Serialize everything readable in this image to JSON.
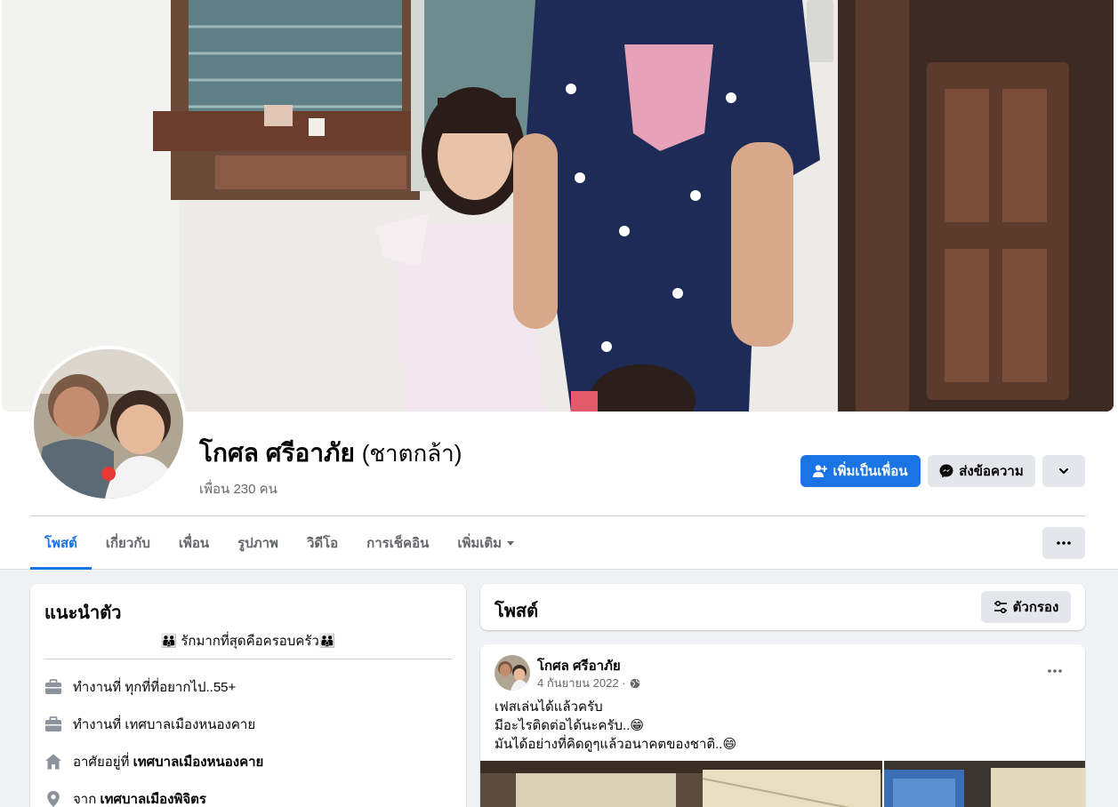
{
  "profile": {
    "name": "โกศล ศรีอาภัย",
    "alternate_name": "(ชาตกล้า)",
    "friends_count": "เพื่อน 230 คน"
  },
  "actions": {
    "add_friend": "เพิ่มเป็นเพื่อน",
    "message": "ส่งข้อความ"
  },
  "tabs": [
    {
      "label": "โพสต์",
      "active": true
    },
    {
      "label": "เกี่ยวกับ"
    },
    {
      "label": "เพื่อน"
    },
    {
      "label": "รูปภาพ"
    },
    {
      "label": "วิดีโอ"
    },
    {
      "label": "การเช็คอิน"
    },
    {
      "label": "เพิ่มเติม"
    }
  ],
  "intro": {
    "title": "แนะนำตัว",
    "bio": "👪 รักมากที่สุดคือครอบครัว👪",
    "items": [
      {
        "icon": "briefcase-icon",
        "prefix": "ทำงานที่ ทุกที่ที่อยากไป..55+",
        "bold": ""
      },
      {
        "icon": "briefcase-icon",
        "prefix": "ทำงานที่ เทศบาลเมืองหนองคาย",
        "bold": ""
      },
      {
        "icon": "home-icon",
        "prefix": "อาศัยอยู่ที่ ",
        "bold": "เทศบาลเมืองหนองคาย"
      },
      {
        "icon": "location-pin-icon",
        "prefix": "จาก ",
        "bold": "เทศบาลเมืองพิจิตร"
      }
    ]
  },
  "posts_header": {
    "title": "โพสต์",
    "filter_label": "ตัวกรอง"
  },
  "post": {
    "author": "โกศล ศรีอาภัย",
    "date": "4 กันยายน 2022 ·",
    "privacy_icon": "globe-icon",
    "lines": [
      "เฟสเล่นได้แล้วครับ",
      "มีอะไรติดต่อได้นะครับ..😁",
      "มันได้อย่างที่คิดดูๆแล้วอนาคตของชาติ..😄"
    ]
  },
  "colors": {
    "accent": "#1b74e4",
    "page_bg": "#f0f2f5",
    "secondary_text": "#65676b",
    "button_grey": "#e4e6eb"
  }
}
